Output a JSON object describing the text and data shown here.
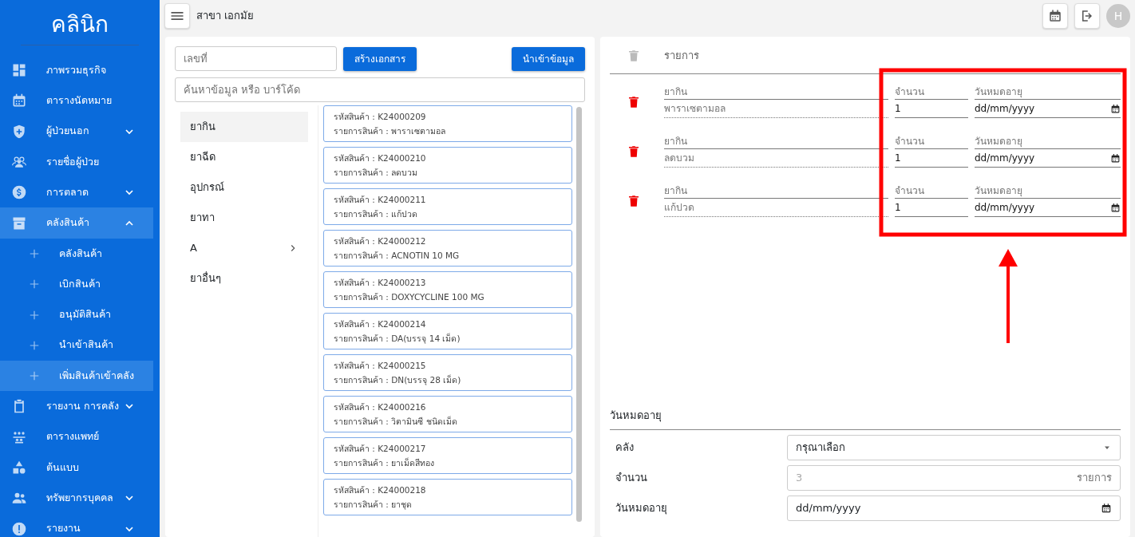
{
  "sidebar": {
    "logo": "คลินิก",
    "items": [
      {
        "label": "ภาพรวมธุรกิจ",
        "selected": false
      },
      {
        "label": "ตารางนัดหมาย",
        "selected": false
      },
      {
        "label": "ผู้ป่วยนอก",
        "selected": false,
        "expanded": false
      },
      {
        "label": "รายชื่อผู้ป่วย",
        "selected": false
      },
      {
        "label": "การตลาด",
        "selected": false,
        "expanded": false
      },
      {
        "label": "คลังสินค้า",
        "selected": true,
        "expanded": true,
        "children": [
          {
            "label": "คลังสินค้า",
            "selected": false
          },
          {
            "label": "เบิกสินค้า",
            "selected": false
          },
          {
            "label": "อนุมัติสินค้า",
            "selected": false
          },
          {
            "label": "นำเข้าสินค้า",
            "selected": false
          },
          {
            "label": "เพิ่มสินค้าเข้าคลัง",
            "selected": true
          }
        ]
      },
      {
        "label": "รายงาน การคลัง",
        "selected": false,
        "expanded": false
      },
      {
        "label": "ตารางแพทย์",
        "selected": false
      },
      {
        "label": "ต้นแบบ",
        "selected": false
      },
      {
        "label": "ทรัพยากรบุคคล",
        "selected": false,
        "expanded": false
      },
      {
        "label": "รายงาน",
        "selected": false,
        "expanded": false
      }
    ]
  },
  "topbar": {
    "branch": "สาขา เอกมัย",
    "avatar": "H"
  },
  "left_panel": {
    "doc_number": {
      "placeholder": "เลขที่"
    },
    "create_button": "สร้างเอกสาร",
    "import_button": "นำเข้าข้อมูล",
    "search": {
      "placeholder": "ค้นหาข้อมูล หรือ บาร์โค้ด"
    },
    "categories": [
      {
        "label": "ยากิน",
        "selected": true,
        "submenu": false
      },
      {
        "label": "ยาฉีด",
        "selected": false,
        "submenu": false
      },
      {
        "label": "อุปกรณ์",
        "selected": false,
        "submenu": false
      },
      {
        "label": "ยาทา",
        "selected": false,
        "submenu": false
      },
      {
        "label": "A",
        "selected": false,
        "submenu": true
      },
      {
        "label": "ยาอื่นๆ",
        "selected": false,
        "submenu": false
      }
    ],
    "products": [
      {
        "code": "รหัสสินค้า : K24000209",
        "name": "รายการสินค้า : พาราเซตามอล"
      },
      {
        "code": "รหัสสินค้า : K24000210",
        "name": "รายการสินค้า : ลดบวม"
      },
      {
        "code": "รหัสสินค้า : K24000211",
        "name": "รายการสินค้า : แก้ปวด"
      },
      {
        "code": "รหัสสินค้า : K24000212",
        "name": "รายการสินค้า : ACNOTIN 10 MG"
      },
      {
        "code": "รหัสสินค้า : K24000213",
        "name": "รายการสินค้า : DOXYCYCLINE 100 MG"
      },
      {
        "code": "รหัสสินค้า : K24000214",
        "name": "รายการสินค้า : DA(บรรจุ 14 เม็ด)"
      },
      {
        "code": "รหัสสินค้า : K24000215",
        "name": "รายการสินค้า : DN(บรรจุ 28 เม็ด)"
      },
      {
        "code": "รหัสสินค้า : K24000216",
        "name": "รายการสินค้า : วิตามินซี ชนิดเม็ด"
      },
      {
        "code": "รหัสสินค้า : K24000217",
        "name": "รายการสินค้า : ยาเม็ดสีทอง"
      },
      {
        "code": "รหัสสินค้า : K24000218",
        "name": "รายการสินค้า : ยาชุด"
      }
    ]
  },
  "right_panel": {
    "header": "รายการ",
    "lines": [
      {
        "category": "ยากิน",
        "name": "พาราเซตามอล",
        "qty_label": "จำนวน",
        "qty": "1",
        "date_label": "วันหมดอายุ",
        "date": "dd/mm/yyyy"
      },
      {
        "category": "ยากิน",
        "name": "ลดบวม",
        "qty_label": "จำนวน",
        "qty": "1",
        "date_label": "วันหมดอายุ",
        "date": "dd/mm/yyyy"
      },
      {
        "category": "ยากิน",
        "name": "แก้ปวด",
        "qty_label": "จำนวน",
        "qty": "1",
        "date_label": "วันหมดอายุ",
        "date": "dd/mm/yyyy"
      }
    ],
    "section_title": "วันหมดอายุ",
    "form": [
      {
        "kind": "select",
        "label": "คลัง",
        "value": "กรุณาเลือก"
      },
      {
        "kind": "count",
        "label": "จำนวน",
        "value": "3",
        "disabled": true,
        "suffix": "รายการ"
      },
      {
        "kind": "date",
        "label": "วันหมดอายุ",
        "value": "dd/mm/yyyy"
      }
    ]
  },
  "annotation": {
    "highlight_box": true,
    "arrow": true
  }
}
